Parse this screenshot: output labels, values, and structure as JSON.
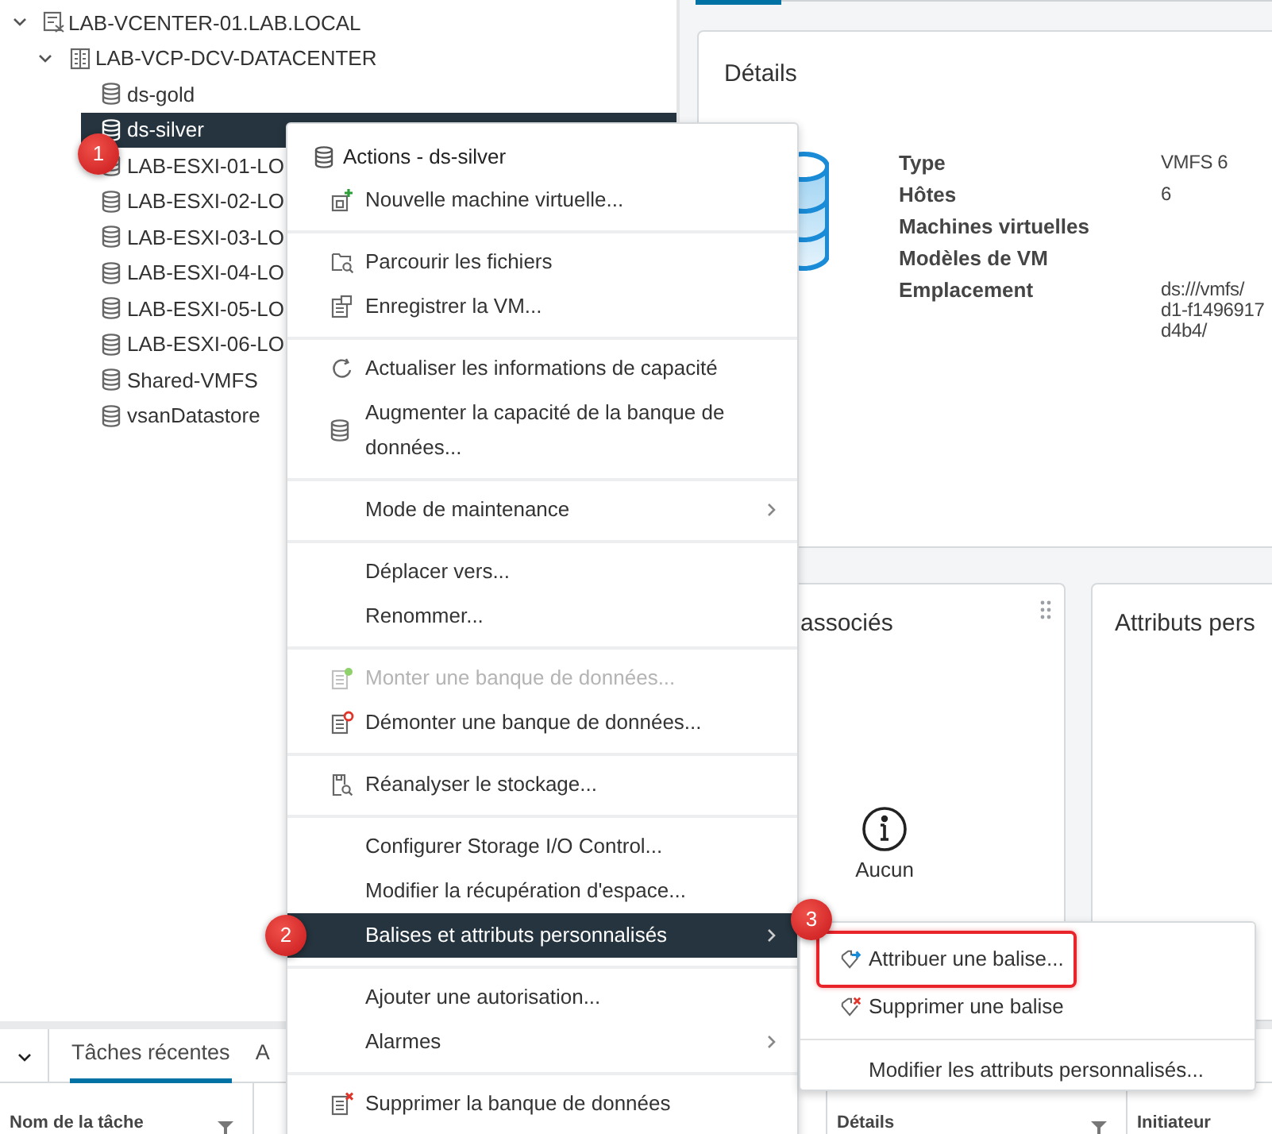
{
  "tree": [
    {
      "label": "LAB-VCENTER-01.LAB.LOCAL",
      "expanded": true,
      "selected": false,
      "children": [
        {
          "label": "LAB-VCP-DCV-DATACENTER",
          "expanded": true,
          "selected": false,
          "children": [
            {
              "label": "ds-gold",
              "selected": false
            },
            {
              "label": "ds-silver",
              "selected": true
            },
            {
              "label": "LAB-ESXI-01-LO",
              "selected": false
            },
            {
              "label": "LAB-ESXI-02-LO",
              "selected": false
            },
            {
              "label": "LAB-ESXI-03-LO",
              "selected": false
            },
            {
              "label": "LAB-ESXI-04-LO",
              "selected": false
            },
            {
              "label": "LAB-ESXI-05-LO",
              "selected": false
            },
            {
              "label": "LAB-ESXI-06-LO",
              "selected": false
            },
            {
              "label": "Shared-VMFS",
              "selected": false
            },
            {
              "label": "vsanDatastore",
              "selected": false
            }
          ]
        }
      ]
    }
  ],
  "details": {
    "title": "Détails",
    "rows": [
      {
        "label": "Type",
        "value": [
          "VMFS 6"
        ]
      },
      {
        "label": "Hôtes",
        "value": [
          "6"
        ]
      },
      {
        "label": "Machines virtuelles",
        "value": []
      },
      {
        "label": "Modèles de VM",
        "value": []
      },
      {
        "label": "Emplacement",
        "value": [
          "ds:///vmfs/",
          "d1-f1496917",
          "d4b4/"
        ]
      }
    ]
  },
  "cards": [
    {
      "title": "associés",
      "empty_text": "Aucun"
    },
    {
      "title": "Attributs pers"
    }
  ],
  "bottom_panel": {
    "tabs": [
      {
        "label": "Tâches récentes",
        "selected": true
      },
      {
        "label": "A",
        "selected": false
      }
    ],
    "columns": [
      "Nom de la tâche",
      "Détails",
      "Initiateur"
    ]
  },
  "context_menu": {
    "title": "Actions - ds-silver",
    "sections": [
      {
        "items": [
          {
            "label": "Nouvelle machine virtuelle...",
            "disabled": false,
            "selected": false,
            "submenu": false
          }
        ]
      },
      {
        "items": [
          {
            "label": "Parcourir les fichiers",
            "disabled": false,
            "selected": false,
            "submenu": false
          },
          {
            "label": "Enregistrer la VM...",
            "disabled": false,
            "selected": false,
            "submenu": false
          }
        ]
      },
      {
        "items": [
          {
            "label": "Actualiser les informations de capacité",
            "disabled": false,
            "selected": false,
            "submenu": false
          },
          {
            "label": "Augmenter la capacité de la banque de données...",
            "disabled": false,
            "selected": false,
            "submenu": false
          }
        ]
      },
      {
        "items": [
          {
            "label": "Mode de maintenance",
            "disabled": false,
            "selected": false,
            "submenu": true
          }
        ]
      },
      {
        "items": [
          {
            "label": "Déplacer vers...",
            "disabled": false,
            "selected": false,
            "submenu": false
          },
          {
            "label": "Renommer...",
            "disabled": false,
            "selected": false,
            "submenu": false
          }
        ]
      },
      {
        "items": [
          {
            "label": "Monter une banque de données...",
            "disabled": true,
            "selected": false,
            "submenu": false
          },
          {
            "label": "Démonter une banque de données...",
            "disabled": false,
            "selected": false,
            "submenu": false
          }
        ]
      },
      {
        "items": [
          {
            "label": "Réanalyser le stockage...",
            "disabled": false,
            "selected": false,
            "submenu": false
          }
        ]
      },
      {
        "items": [
          {
            "label": "Configurer Storage I/O Control...",
            "disabled": false,
            "selected": false,
            "submenu": false
          },
          {
            "label": "Modifier la récupération d'espace...",
            "disabled": false,
            "selected": false,
            "submenu": false
          },
          {
            "label": "Balises et attributs personnalisés",
            "disabled": false,
            "selected": true,
            "submenu": true
          }
        ]
      },
      {
        "items": [
          {
            "label": "Ajouter une autorisation...",
            "disabled": false,
            "selected": false,
            "submenu": false
          },
          {
            "label": "Alarmes",
            "disabled": false,
            "selected": false,
            "submenu": true
          }
        ]
      },
      {
        "items": [
          {
            "label": "Supprimer la banque de données",
            "disabled": false,
            "selected": false,
            "submenu": false
          }
        ]
      }
    ]
  },
  "submenu": {
    "sections": [
      {
        "items": [
          {
            "label": "Attribuer une balise...",
            "highlighted": true
          },
          {
            "label": "Supprimer une balise",
            "highlighted": false
          }
        ]
      },
      {
        "items": [
          {
            "label": "Modifier les attributs personnalisés...",
            "highlighted": false
          }
        ]
      }
    ]
  },
  "annotations": [
    {
      "label": "1"
    },
    {
      "label": "2"
    },
    {
      "label": "3"
    }
  ]
}
